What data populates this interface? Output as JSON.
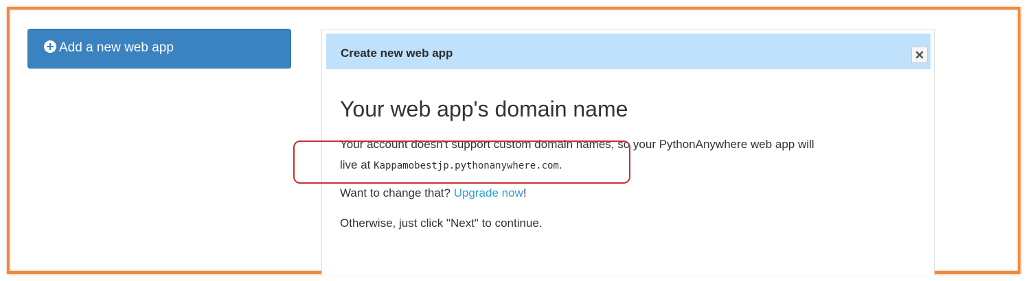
{
  "sidebar": {
    "add_button_label": "Add a new web app"
  },
  "dialog": {
    "title": "Create new web app",
    "heading": "Your web app's domain name",
    "line1": "Your account doesn't support custom domain names, so your PythonAnywhere web app will",
    "line2_prefix": "live at ",
    "domain": "Kappamobestjp.pythonanywhere.com",
    "line2_suffix": ".",
    "change_prompt": "Want to change that? ",
    "upgrade_link": "Upgrade now",
    "upgrade_suffix": "!",
    "otherwise_text": "Otherwise, just click \"Next\" to continue."
  },
  "icons": {
    "add": "plus-circle-icon",
    "close": "close-icon"
  },
  "colors": {
    "frame_border": "#ee8a3f",
    "primary_button": "#3b82c1",
    "header_bg": "#bfe1fb",
    "link": "#2e9fd6",
    "annotation": "#cc2f2f"
  }
}
